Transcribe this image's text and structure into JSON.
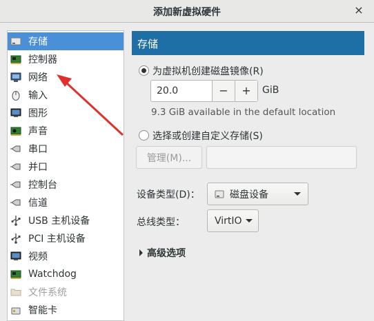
{
  "window": {
    "title": "添加新虚拟硬件",
    "close_glyph": "×"
  },
  "sidebar": {
    "items": [
      {
        "label": "存储",
        "icon": "disk-icon"
      },
      {
        "label": "控制器",
        "icon": "controller-icon"
      },
      {
        "label": "网络",
        "icon": "network-icon"
      },
      {
        "label": "输入",
        "icon": "mouse-icon"
      },
      {
        "label": "图形",
        "icon": "display-icon"
      },
      {
        "label": "声音",
        "icon": "sound-card-icon"
      },
      {
        "label": "串口",
        "icon": "serial-port-icon"
      },
      {
        "label": "并口",
        "icon": "parallel-port-icon"
      },
      {
        "label": "控制台",
        "icon": "console-icon"
      },
      {
        "label": "信道",
        "icon": "channel-icon"
      },
      {
        "label": "USB 主机设备",
        "icon": "usb-icon"
      },
      {
        "label": "PCI 主机设备",
        "icon": "pci-icon"
      },
      {
        "label": "视频",
        "icon": "video-icon"
      },
      {
        "label": "Watchdog",
        "icon": "watchdog-icon"
      },
      {
        "label": "文件系统",
        "icon": "folder-icon"
      },
      {
        "label": "智能卡",
        "icon": "smartcard-icon"
      }
    ]
  },
  "main": {
    "section_title": "存储",
    "create_disk_label": "为虚拟机创建磁盘镜像(R)",
    "size_value": "20.0",
    "size_unit": "GiB",
    "minus": "−",
    "plus": "+",
    "available_text": "9.3 GiB available in the default location",
    "custom_storage_label": "选择或创建自定义存储(S)",
    "manage_button": "管理(M)...",
    "device_type_label": "设备类型(D)：",
    "device_type_value": "磁盘设备",
    "bus_type_label": "总线类型：",
    "bus_type_value": "VirtIO",
    "advanced_label": "高级选项"
  },
  "colors": {
    "selection": "#4a90d9",
    "header": "#1d6fa5",
    "annotation_arrow": "#e0302c"
  }
}
